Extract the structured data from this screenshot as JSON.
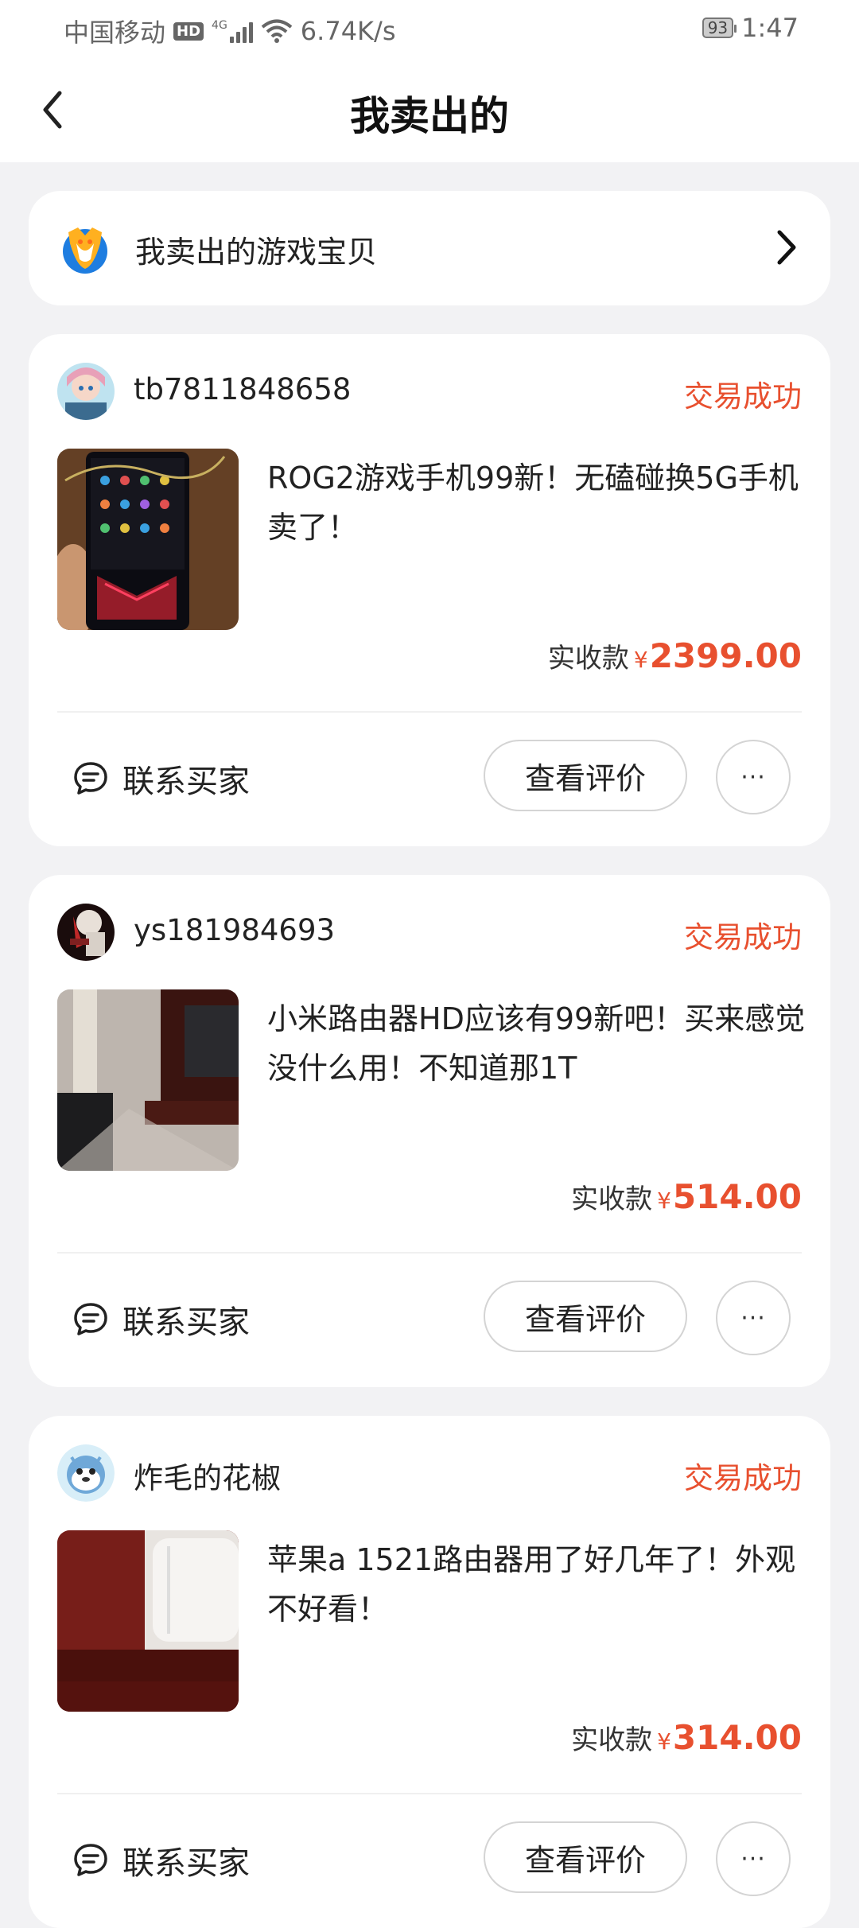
{
  "status_bar": {
    "carrier": "中国移动",
    "hd": "HD",
    "network_type": "4G",
    "speed": "6.74K/s",
    "battery": "93",
    "time": "1:47"
  },
  "nav": {
    "title": "我卖出的"
  },
  "game_entry": {
    "label": "我卖出的游戏宝贝"
  },
  "orders": [
    {
      "username": "tb7811848658",
      "status": "交易成功",
      "title": "ROG2游戏手机99新！无磕碰换5G手机卖了！",
      "price_label": "实收款",
      "currency": "¥",
      "price": "2399.00",
      "contact_label": "联系买家",
      "review_label": "查看评价",
      "more_label": "···"
    },
    {
      "username": "ys181984693",
      "status": "交易成功",
      "title": "小米路由器HD应该有99新吧！买来感觉没什么用！不知道那1T",
      "price_label": "实收款",
      "currency": "¥",
      "price": "514.00",
      "contact_label": "联系买家",
      "review_label": "查看评价",
      "more_label": "···"
    },
    {
      "username": "炸毛的花椒",
      "status": "交易成功",
      "title": "苹果a 1521路由器用了好几年了！外观不好看！",
      "price_label": "实收款",
      "currency": "¥",
      "price": "314.00",
      "contact_label": "联系买家",
      "review_label": "查看评价",
      "more_label": "···"
    }
  ],
  "colors": {
    "accent": "#e8502f",
    "background": "#f2f2f4"
  }
}
